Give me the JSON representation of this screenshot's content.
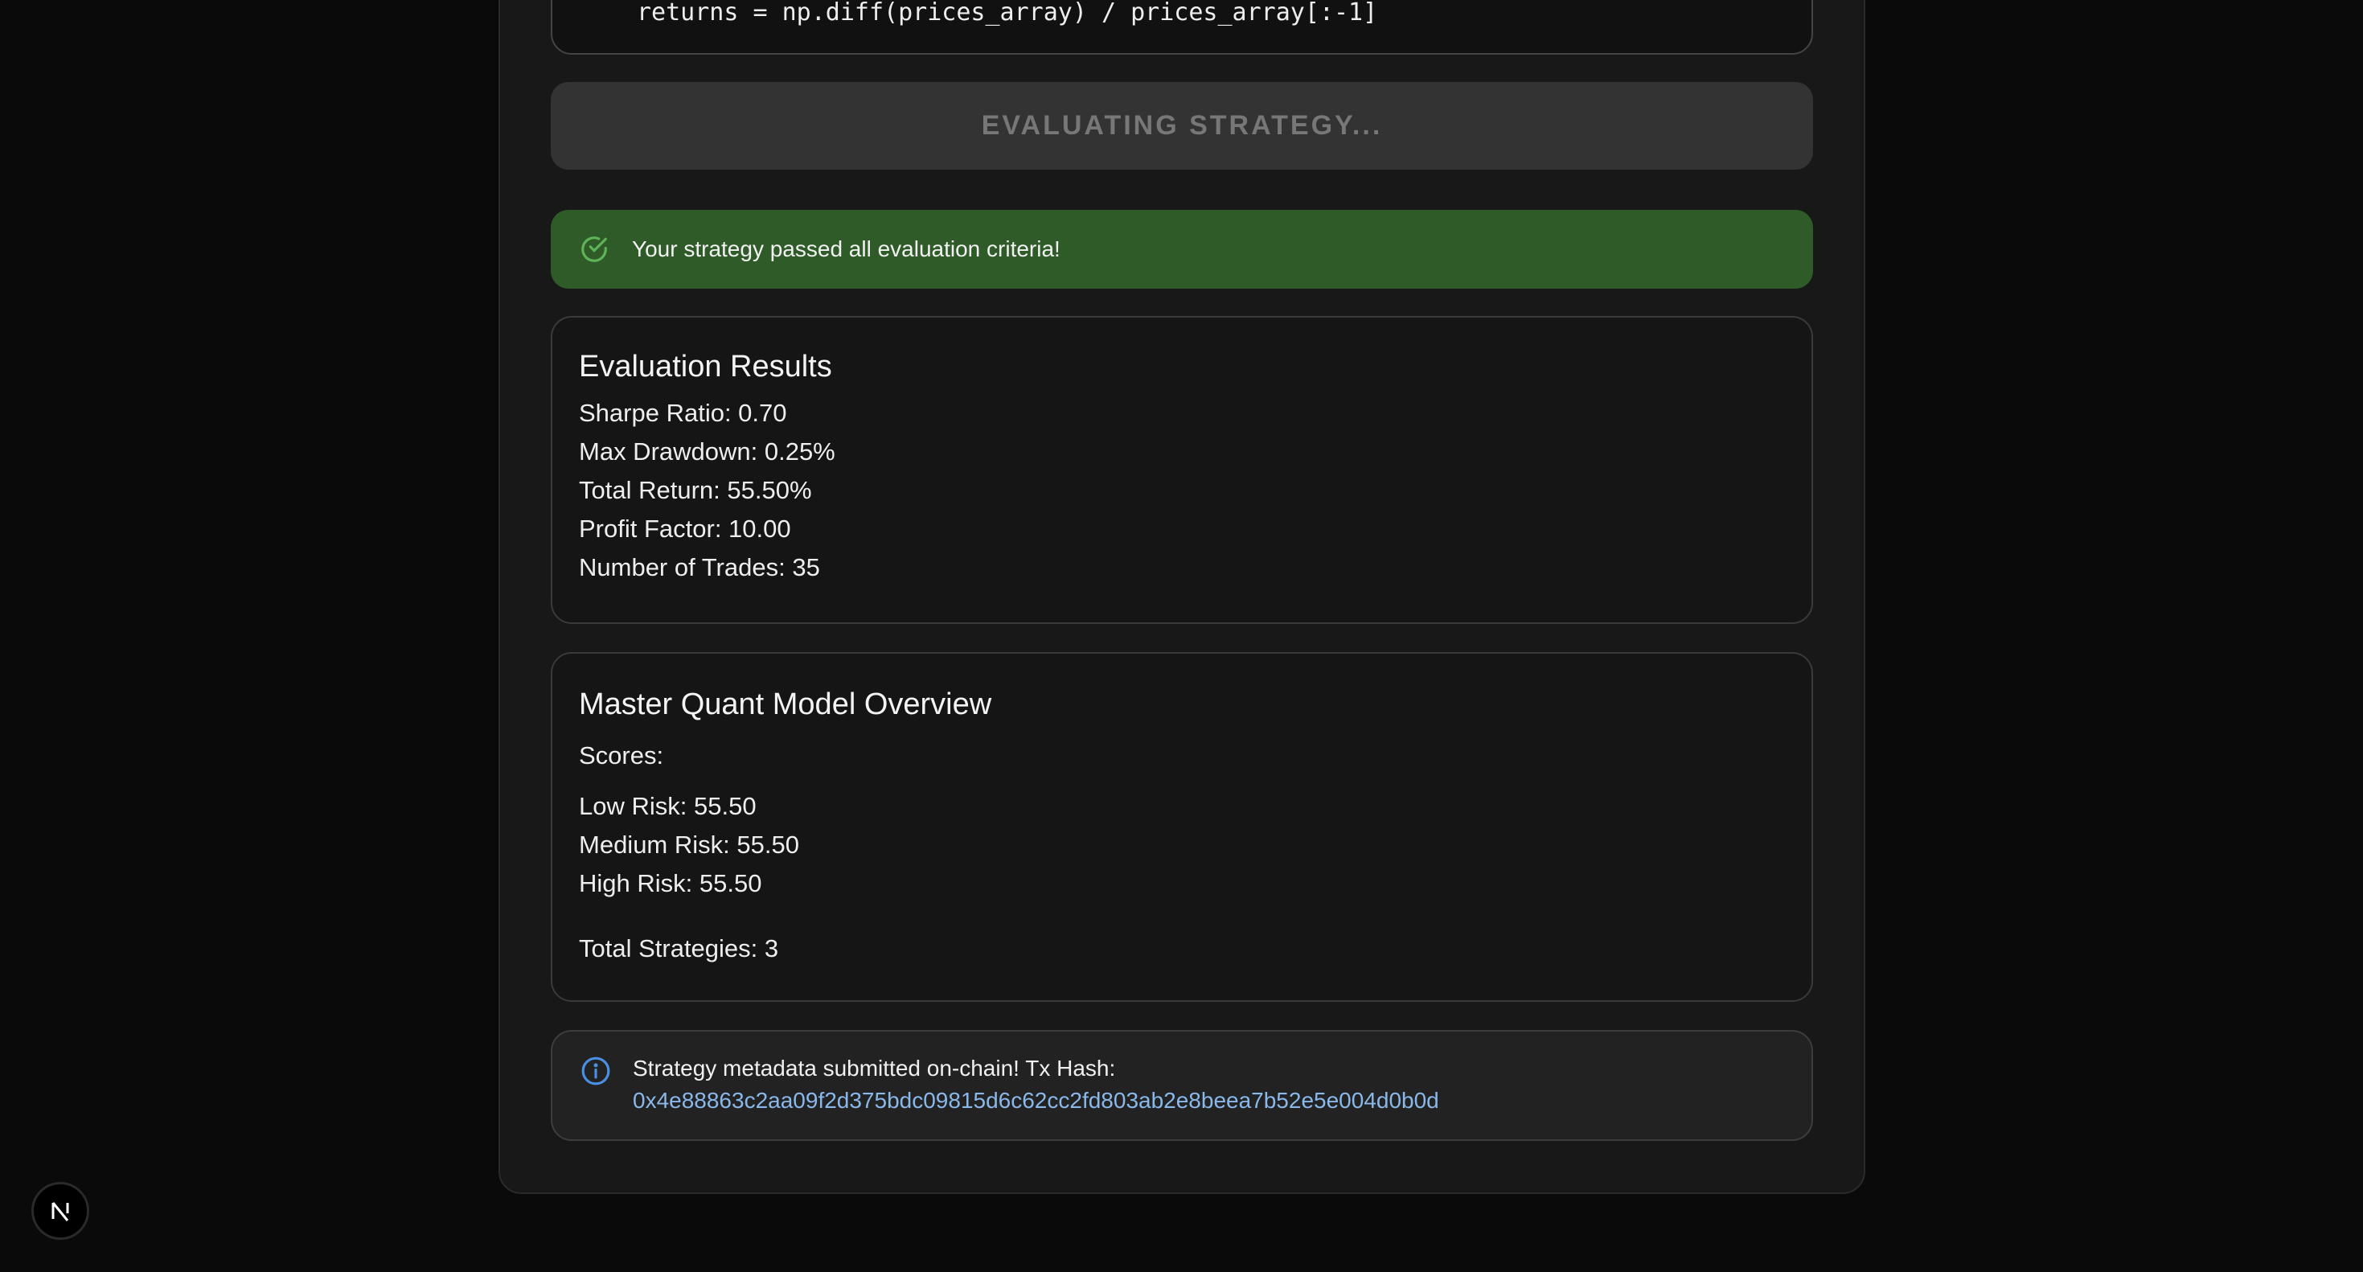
{
  "code": {
    "line": "returns = np.diff(prices_array) / prices_array[:-1]"
  },
  "evaluate_button": {
    "label": "EVALUATING STRATEGY..."
  },
  "success_alert": {
    "message": "Your strategy passed all evaluation criteria!",
    "icon": "check-circle-icon",
    "color": "#2e5b28"
  },
  "evaluation_results": {
    "title": "Evaluation Results",
    "lines": [
      "Sharpe Ratio: 0.70",
      "Max Drawdown: 0.25%",
      "Total Return: 55.50%",
      "Profit Factor: 10.00",
      "Number of Trades: 35"
    ]
  },
  "master_model": {
    "title": "Master Quant Model Overview",
    "scores_label": "Scores:",
    "scores": [
      "Low Risk: 55.50",
      "Medium Risk: 55.50",
      "High Risk: 55.50"
    ],
    "total": "Total Strategies: 3"
  },
  "info_alert": {
    "message": "Strategy metadata submitted on-chain! Tx Hash:",
    "tx_hash": "0x4e88863c2aa09f2d375bdc09815d6c62cc2fd803ab2e8beea7b52e5e004d0b0d",
    "icon": "info-circle-icon",
    "link_color": "#8ab8ea"
  },
  "dev_badge": {
    "icon": "nextjs-logo-icon",
    "letter": "N"
  }
}
